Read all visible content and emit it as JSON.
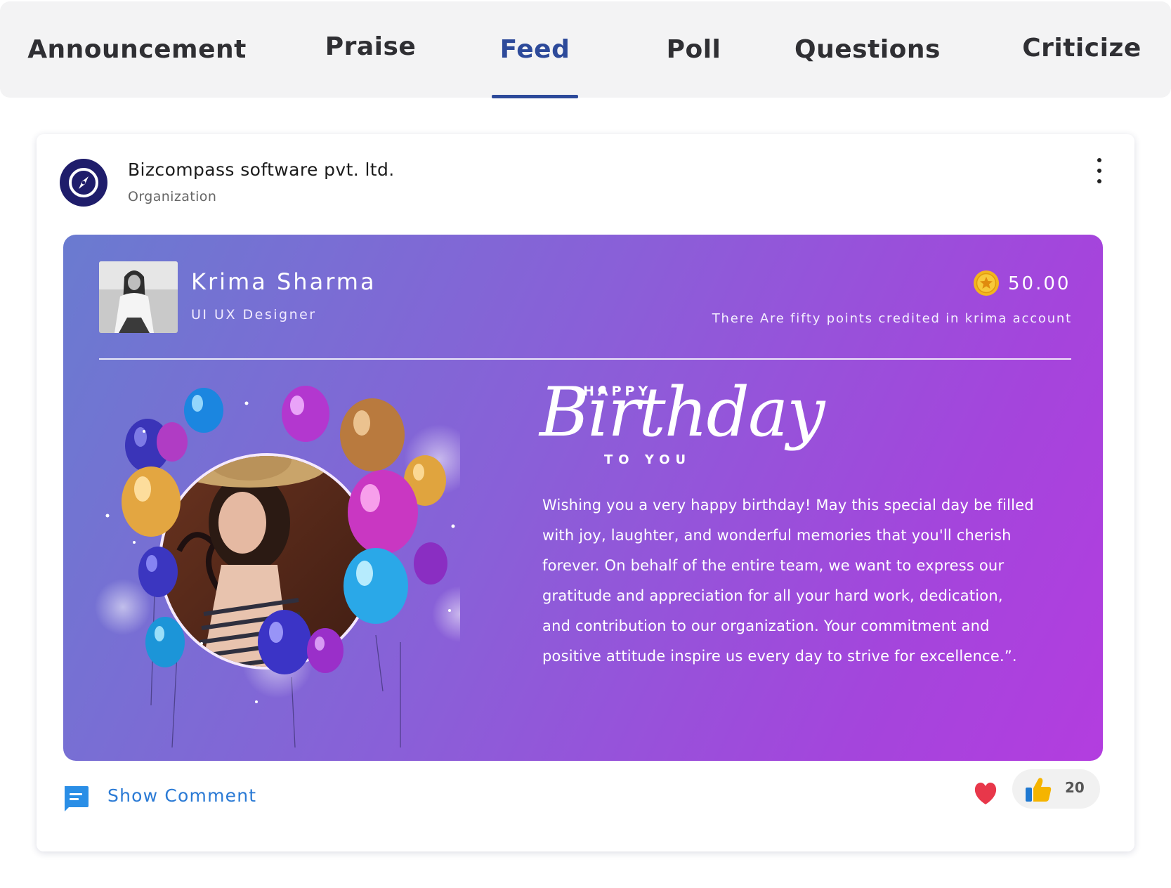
{
  "tabs": [
    {
      "label": "Announcement"
    },
    {
      "label": "Praise"
    },
    {
      "label": "Feed",
      "active": true
    },
    {
      "label": "Poll"
    },
    {
      "label": "Questions"
    },
    {
      "label": "Criticize"
    }
  ],
  "colors": {
    "accent": "#2d4a9a",
    "link": "#2a7ad5",
    "banner_start": "#6a7bd0",
    "banner_end": "#b33ddf",
    "heart": "#e8374a",
    "thumb": "#f5b400"
  },
  "post": {
    "org_name": "Bizcompass software pvt. ltd.",
    "org_type": "Organization",
    "org_logo_icon": "compass-icon",
    "menu_icon": "kebab-menu-icon",
    "banner": {
      "person_name": "Krima Sharma",
      "person_role": "UI UX Designer",
      "points": "50.00",
      "points_icon": "coin-star-icon",
      "points_note": "There Are fifty points credited in krima account",
      "greeting_top": "HAPPY",
      "greeting_main": "Birthday",
      "greeting_bottom": "TO YOU",
      "message": "Wishing you a very happy birthday! May this special day be filled with joy, laughter, and wonderful memories that you'll cherish forever. On behalf of the entire team, we want to express our gratitude and appreciation for all your hard work, dedication, and contribution to our organization. Your commitment and positive attitude inspire us every day to strive for excellence.”."
    },
    "footer": {
      "show_comment": "Show Comment",
      "comment_icon": "comment-icon",
      "heart_icon": "heart-icon",
      "like_icon": "thumbs-up-icon",
      "like_count": "20"
    }
  }
}
